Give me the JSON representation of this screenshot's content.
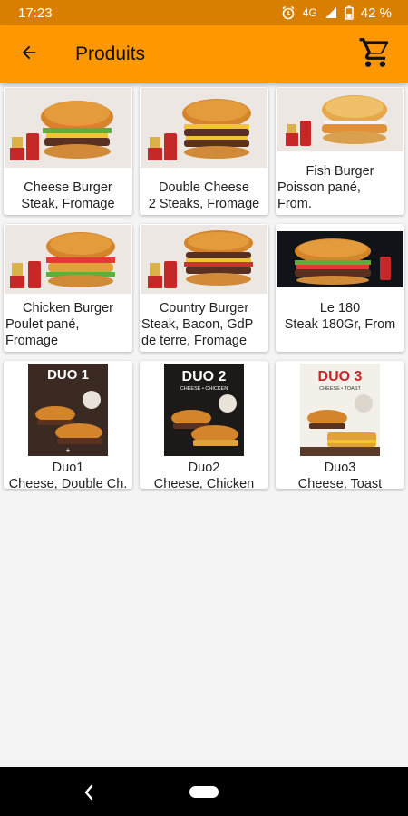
{
  "status_bar": {
    "time": "17:23",
    "network": "4G",
    "battery": "42 %"
  },
  "app_bar": {
    "title": "Produits",
    "back_icon": "arrow-back-icon",
    "cart_icon": "cart-icon"
  },
  "colors": {
    "app_bar": "#ff9800",
    "status_bar": "#d97f00"
  },
  "products": [
    {
      "name": "Cheese Burger",
      "description": "Steak, Fromage"
    },
    {
      "name": "Double Cheese",
      "description": "2 Steaks, Fromage"
    },
    {
      "name": "Fish Burger",
      "description": "Poisson pané,\nFrom."
    },
    {
      "name": "Chicken Burger",
      "description": "Poulet pané,\nFromage"
    },
    {
      "name": "Country Burger",
      "description": "Steak, Bacon, GdP\nde terre, Fromage"
    },
    {
      "name": "Le 180",
      "description": "Steak 180Gr, From"
    },
    {
      "name": "Duo1",
      "description": "Cheese, Double Ch.",
      "image_text": "DUO 1"
    },
    {
      "name": "Duo2",
      "description": "Cheese, Chicken",
      "image_text": "DUO 2",
      "image_subtext": "CHEESE • CHICKEN"
    },
    {
      "name": "Duo3",
      "description": "Cheese, Toast",
      "image_text": "DUO 3",
      "image_subtext": "CHEESE • TOAST"
    }
  ]
}
